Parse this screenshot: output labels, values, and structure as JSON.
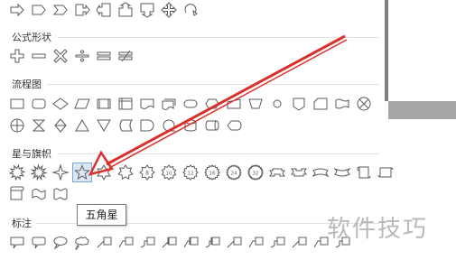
{
  "sections": [
    {
      "key": "formula",
      "title": "公式形状"
    },
    {
      "key": "flowchart",
      "title": "流程图"
    },
    {
      "key": "stars",
      "title": "星与旗帜"
    },
    {
      "key": "callouts",
      "title": "标注"
    }
  ],
  "tooltip": {
    "text": "五角星"
  },
  "watermark": {
    "text": "软件技巧"
  },
  "colors": {
    "icon_stroke": "#5b5b5b",
    "annotation_arrow": "#d9302a",
    "selected_bg": "#dbe6f5"
  },
  "rows": {
    "block_arrows": [
      "arrow-right-outline-icon",
      "pentagon-arrow-icon",
      "chevron-arrow-icon",
      "up-right-arrow-icon",
      "left-arrow-callout-icon",
      "up-arrow-callout-icon",
      "down-arrow-callout-icon",
      "quad-arrow-callout-icon",
      "circular-arrow-icon"
    ],
    "formula": [
      "plus-shape-icon",
      "minus-shape-icon",
      "multiply-shape-icon",
      "divide-shape-icon",
      "equal-shape-icon",
      "not-equal-shape-icon"
    ],
    "flowchart_row1": [
      "process-icon",
      "alternate-process-icon",
      "decision-icon",
      "data-icon",
      "predefined-process-icon",
      "internal-storage-icon",
      "document-icon",
      "multidocument-icon",
      "terminator-icon",
      "preparation-icon",
      "manual-input-icon",
      "manual-operation-icon",
      "connector-icon",
      "offpage-connector-icon",
      "punched-card-icon",
      "punched-tape-icon",
      "summing-junction-icon"
    ],
    "flowchart_row2": [
      "or-icon",
      "collate-icon",
      "sort-icon",
      "extract-icon",
      "merge-icon",
      "stored-data-icon",
      "delay-icon",
      "sequential-access-icon",
      "magnetic-disk-icon",
      "direct-access-icon",
      "display-icon"
    ],
    "stars_row1": [
      "explosion-1-icon",
      "explosion-2-icon",
      "four-point-star-icon",
      "five-point-star-icon",
      "six-point-star-icon",
      "seven-point-star-icon",
      "eight-point-star-icon",
      "ten-point-star-icon",
      "twelve-point-star-icon",
      "sixteen-point-star-icon",
      "twenty-four-point-star-icon",
      "thirty-two-point-star-icon",
      "up-ribbon-icon",
      "down-ribbon-icon",
      "curved-up-ribbon-icon",
      "curved-down-ribbon-icon",
      "vertical-scroll-icon",
      "horizontal-scroll-icon"
    ],
    "stars_row2": [
      "horizontal-scroll-2-icon",
      "wave-icon",
      "double-wave-icon"
    ],
    "callouts": [
      "rectangular-callout-icon",
      "rounded-callout-icon",
      "oval-callout-icon",
      "cloud-callout-icon",
      "line-callout-1-icon",
      "line-callout-2-icon",
      "line-callout-3-icon",
      "line-callout-1-accent-icon",
      "line-callout-2-accent-icon",
      "line-callout-3-accent-icon",
      "line-callout-1-border-icon",
      "line-callout-2-border-icon",
      "line-callout-3-border-icon",
      "line-callout-1-no-border-icon",
      "line-callout-2-no-border-icon",
      "line-callout-3-no-border-icon"
    ]
  }
}
